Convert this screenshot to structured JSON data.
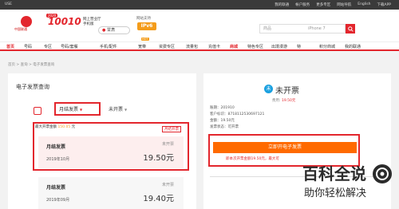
{
  "topbar": {
    "left": "USE",
    "links": [
      "我的联通",
      "帐户服务",
      "更多专区",
      "网站导航",
      "English",
      "下载APP"
    ]
  },
  "header": {
    "logo_cn": "中国联通",
    "logo_number": "10010",
    "logo_badge": "2020",
    "slogan_line1": "网上营业厅",
    "slogan_line2": "手机版",
    "city": "甘肃",
    "ipv6_label": "网站支持",
    "ipv6": "IPv6",
    "search_prefix": "商品",
    "search_placeholder": "iPhone 7"
  },
  "nav": {
    "items": [
      "首页",
      "号码",
      "专区",
      "号码/套餐",
      "手机/配件",
      "宽带",
      "资费专区",
      "流量包",
      "充值卡",
      "商城",
      "特色专区",
      "出境漫游",
      "特",
      "积分商城",
      "我的联通"
    ],
    "hot_tag": "HOT"
  },
  "breadcrumb": "首页 > 查询 > 电子发票查询",
  "left": {
    "title": "电子发票查询",
    "tab_monthly": "月结发票",
    "tab_unbilled": "未开票",
    "max_amount_label": "最大开票金额",
    "max_amount_value": "150.05",
    "max_amount_unit": "元",
    "tag": "月结开票",
    "cards": [
      {
        "name": "月结发票",
        "date": "2019年10月",
        "status": "未开票",
        "amount": "19.50元"
      },
      {
        "name": "月结发票",
        "date": "2019年09月",
        "status": "未开票",
        "amount": "19.40元"
      }
    ]
  },
  "right": {
    "icon_text": "未",
    "title": "未开票",
    "fee_label": "费用:",
    "fee_value": "19.50元",
    "info": [
      "账期：201910",
      "客户标识：8718112530697121",
      "金额：19.50元",
      "发票状态：可开票"
    ],
    "button": "立即开电子发票",
    "note": "即本次开票金额19.50元，最大可"
  },
  "watermark": {
    "title": "百科全说",
    "subtitle": "助你轻松解决"
  },
  "colors": {
    "brand": "#e3262d",
    "orange": "#ff6a00",
    "accent": "#f49c1a"
  }
}
